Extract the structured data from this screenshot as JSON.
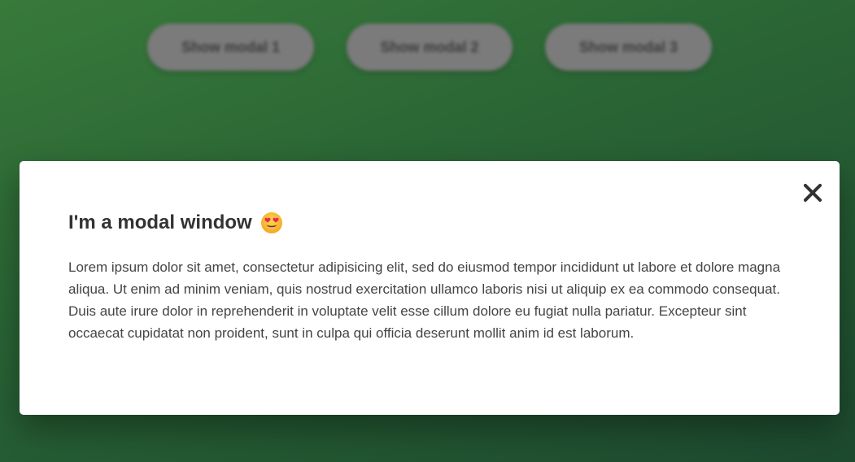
{
  "buttons": [
    {
      "label": "Show modal 1"
    },
    {
      "label": "Show modal 2"
    },
    {
      "label": "Show modal 3"
    }
  ],
  "modal": {
    "title": "I'm a modal window",
    "title_emoji": "smiling-face-with-heart-eyes-icon",
    "body": "Lorem ipsum dolor sit amet, consectetur adipisicing elit, sed do eiusmod tempor incididunt ut labore et dolore magna aliqua. Ut enim ad minim veniam, quis nostrud exercitation ullamco laboris nisi ut aliquip ex ea commodo consequat. Duis aute irure dolor in reprehenderit in voluptate velit esse cillum dolore eu fugiat nulla pariatur. Excepteur sint occaecat cupidatat non proident, sunt in culpa qui officia deserunt mollit anim id est laborum.",
    "close_icon": "close-icon"
  },
  "colors": {
    "overlay_green": "#2a6535",
    "modal_bg": "#ffffff",
    "text": "#333333",
    "button_bg": "#7b7b7b"
  }
}
